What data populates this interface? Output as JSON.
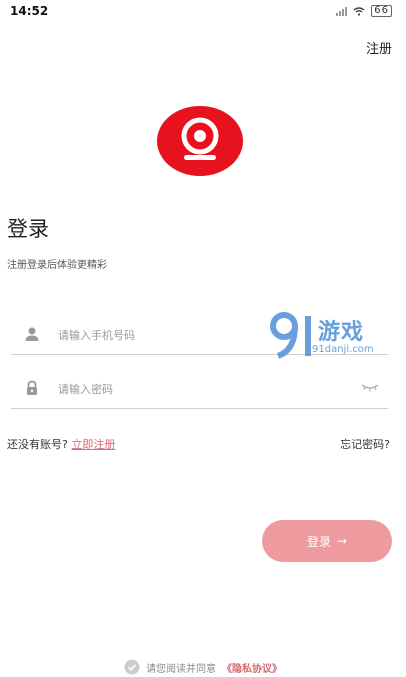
{
  "status": {
    "time": "14:52",
    "battery": "66"
  },
  "header": {
    "register_label": "注册"
  },
  "page": {
    "title": "登录",
    "subtitle": "注册登录后体验更精彩"
  },
  "form": {
    "phone_placeholder": "请输入手机号码",
    "password_placeholder": "请输入密码",
    "no_account_text": "还没有账号?",
    "register_link": "立即注册",
    "forgot_label": "忘记密码?",
    "login_label": "登录",
    "login_arrow": "→"
  },
  "agreement": {
    "text": "请您阅读并同意",
    "policy_link": "《隐私协议》"
  },
  "watermark": {
    "brand": "游戏",
    "url": "91danji.com"
  },
  "colors": {
    "accent": "#ee9ba0",
    "link": "#d66b70",
    "logo_red": "#e8121f"
  }
}
